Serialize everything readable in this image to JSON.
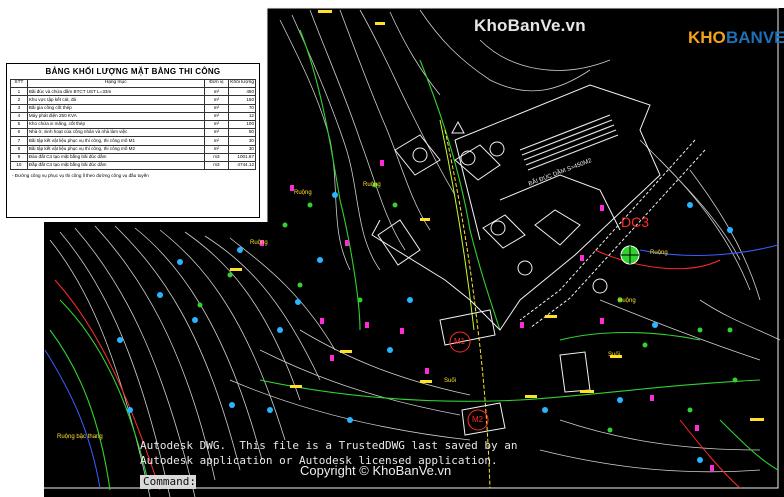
{
  "app": {
    "brand_name": "KhoBanVe.vn",
    "logo_part1": "KHO",
    "logo_part2": "BANVE"
  },
  "table": {
    "title": "BẢNG KHỐI LƯỢNG MẶT BẰNG THI CÔNG",
    "headers": [
      "STT",
      "Hạng mục",
      "Đơn vị",
      "Khối lượng"
    ],
    "rows": [
      [
        "1",
        "Bãi đúc và chứa dầm BTCT UST L=33m",
        "m²",
        "450"
      ],
      [
        "2",
        "Khu vực tập kết cát, đá",
        "m²",
        "150"
      ],
      [
        "3",
        "Bãi gia công cốt thép",
        "m²",
        "70"
      ],
      [
        "4",
        "Máy phát điện 250 KVA",
        "m²",
        "12"
      ],
      [
        "5",
        "Kho chứa xi măng, cốt thép",
        "m²",
        "100"
      ],
      [
        "6",
        "Nhà ở, sinh hoạt của công nhân và nhà làm việc",
        "m²",
        "50"
      ],
      [
        "7",
        "Bãi tập kết vật liệu phục vụ thi công, thi công mố M1",
        "m²",
        "30"
      ],
      [
        "8",
        "Bãi tập kết vật liệu phục vụ thi công, thi công mố M2",
        "m²",
        "30"
      ],
      [
        "9",
        "Đào đất C4 tạo mặt bằng bãi đúc dầm",
        "m3",
        "1001.67"
      ],
      [
        "10",
        "Đắp đất C4 tạo mặt bằng bãi đúc dầm",
        "m3",
        "4744.12"
      ]
    ],
    "note": "- Đường công vụ phục vụ thi công lỉ theo đường công vụ đầu tuyến"
  },
  "drawing_labels": {
    "yard": "BÃI ĐÚC DẦM  S=450M2",
    "dc3": "DC3",
    "m1": "M1",
    "m2": "M2",
    "ruong": "Ruộng",
    "suoi": "Suối",
    "ruong_bac_thang": "Ruộng bậc thang"
  },
  "status_bar": {
    "watermark_line1": "Autodesk DWG.  This file is a TrustedDWG last saved by an",
    "watermark_line2": "Autodesk application or Autodesk licensed application.",
    "copyright": "Copyright © KhoBanVe.vn",
    "command_label": "Command:"
  },
  "colors": {
    "background": "#000000",
    "contour": "#d9d9d9",
    "road_green": "#31d12f",
    "accent_red": "#ff2a2a",
    "label_yellow": "#ffe12a",
    "magenta": "#ff2bd6",
    "cyan": "#27b6ff"
  }
}
